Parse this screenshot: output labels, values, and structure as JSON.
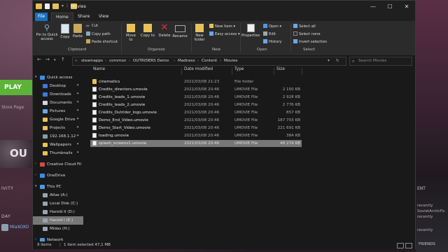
{
  "window": {
    "title": "Movies",
    "controls": [
      "—",
      "☐",
      "✕"
    ]
  },
  "ribbon_tabs": [
    "File",
    "Home",
    "Share",
    "View"
  ],
  "ribbon": {
    "clipboard": {
      "group": "Clipboard",
      "pin": "Pin to Quick access",
      "copy": "Copy",
      "paste": "Paste",
      "cut": "Cut",
      "copy_path": "Copy path",
      "paste_shortcut": "Paste shortcut"
    },
    "organize": {
      "group": "Organize",
      "move_to": "Move to",
      "copy_to": "Copy to",
      "delete": "Delete",
      "rename": "Rename"
    },
    "new": {
      "group": "New",
      "new_folder": "New folder",
      "new_item": "New item",
      "easy_access": "Easy access"
    },
    "open": {
      "group": "Open",
      "properties": "Properties",
      "open": "Open",
      "edit": "Edit",
      "history": "History"
    },
    "select": {
      "group": "Select",
      "select_all": "Select all",
      "select_none": "Select none",
      "invert_selection": "Invert selection"
    }
  },
  "address": {
    "crumbs": [
      "steamapps",
      "common",
      "OUTRIDERS Demo",
      "Madness",
      "Content",
      "Movies"
    ],
    "search_placeholder": "Search Movies"
  },
  "nav_pane": [
    {
      "label": "Quick access",
      "icon": "star-icon",
      "color": "#3b8fe0"
    },
    {
      "label": "Desktop",
      "icon": "desktop-icon",
      "color": "#3d7ad6",
      "pinned": true
    },
    {
      "label": "Downloads",
      "icon": "download-icon",
      "color": "#3d7ad6",
      "pinned": true
    },
    {
      "label": "Documents",
      "icon": "document-icon",
      "color": "#cfd6e0",
      "pinned": true
    },
    {
      "label": "Pictures",
      "icon": "pictures-icon",
      "color": "#6aa6e8",
      "pinned": true
    },
    {
      "label": "Google Drive",
      "icon": "drive-icon",
      "color": "#e8c15a",
      "pinned": true
    },
    {
      "label": "Projects",
      "icon": "folder-icon",
      "color": "#e8c15a",
      "pinned": true
    },
    {
      "label": "192.168.1.12",
      "icon": "network-drive-icon",
      "color": "#8a9aa8",
      "pinned": true
    },
    {
      "label": "Wallpapers",
      "icon": "folder-icon",
      "color": "#e8c15a",
      "pinned": true
    },
    {
      "label": "Thumbnails",
      "icon": "folder-icon",
      "color": "#e8c15a",
      "pinned": true
    },
    {
      "label": "Creative Cloud Fil",
      "icon": "creative-cloud-icon",
      "color": "#d24a4a"
    },
    {
      "label": "OneDrive",
      "icon": "onedrive-icon",
      "color": "#3b8fe0"
    },
    {
      "label": "This PC",
      "icon": "pc-icon",
      "color": "#4a9ae0"
    },
    {
      "label": "Atlas (A:)",
      "icon": "drive-icon",
      "color": "#9aa4ad"
    },
    {
      "label": "Local Disk (C:)",
      "icon": "drive-icon",
      "color": "#9aa4ad"
    },
    {
      "label": "Harold II (D:)",
      "icon": "drive-icon",
      "color": "#9aa4ad"
    },
    {
      "label": "Harold I (E:)",
      "icon": "drive-icon",
      "color": "#9aa4ad",
      "selected": true
    },
    {
      "label": "Midas (H:)",
      "icon": "drive-icon",
      "color": "#9aa4ad"
    },
    {
      "label": "Network",
      "icon": "network-icon",
      "color": "#4a9ae0"
    }
  ],
  "columns": {
    "name": "Name",
    "date": "Date modified",
    "type": "Type",
    "size": "Size"
  },
  "files": [
    {
      "name": "cinematics",
      "date": "2021/03/08 21:23",
      "type": "File folder",
      "size": "",
      "kind": "folder"
    },
    {
      "name": "Credits_directors.umovie",
      "date": "2021/03/08 20:46",
      "type": "UMOVIE File",
      "size": "2 100 KB",
      "kind": "file"
    },
    {
      "name": "Credits_leads_1.umovie",
      "date": "2021/03/08 20:46",
      "type": "UMOVIE File",
      "size": "2 928 KB",
      "kind": "file"
    },
    {
      "name": "Credits_leads_2.umovie",
      "date": "2021/03/08 20:46",
      "type": "UMOVIE File",
      "size": "2 776 KB",
      "kind": "file"
    },
    {
      "name": "Credits_Outrider_logo.umovie",
      "date": "2021/03/08 20:46",
      "type": "UMOVIE File",
      "size": "857 KB",
      "kind": "file"
    },
    {
      "name": "Demo_End_Video.umovie",
      "date": "2021/03/08 20:46",
      "type": "UMOVIE File",
      "size": "187 703 KB",
      "kind": "file"
    },
    {
      "name": "Demo_Start_Video.umovie",
      "date": "2021/03/08 20:46",
      "type": "UMOVIE File",
      "size": "221 691 KB",
      "kind": "file"
    },
    {
      "name": "loading.umovie",
      "date": "2021/03/08 20:46",
      "type": "UMOVIE File",
      "size": "384 KB",
      "kind": "file"
    },
    {
      "name": "splash_screens1.umovie",
      "date": "2021/03/08 20:46",
      "type": "UMOVIE File",
      "size": "48 274 KB",
      "kind": "file",
      "selected": true
    }
  ],
  "status": {
    "items": "9 items",
    "selected": "1 item selected  47,1 MB"
  },
  "background": {
    "play": "PLAY",
    "store_page": "Store Page",
    "game_logo": "OU",
    "activity": "IVITY",
    "today": "DAY",
    "username": "MiaXOXO",
    "right_header": "ENT",
    "right_text": "recently\nSovietArcticFo\nrecently",
    "right_text_3": "recently",
    "right_footer": "FRIENDS"
  }
}
